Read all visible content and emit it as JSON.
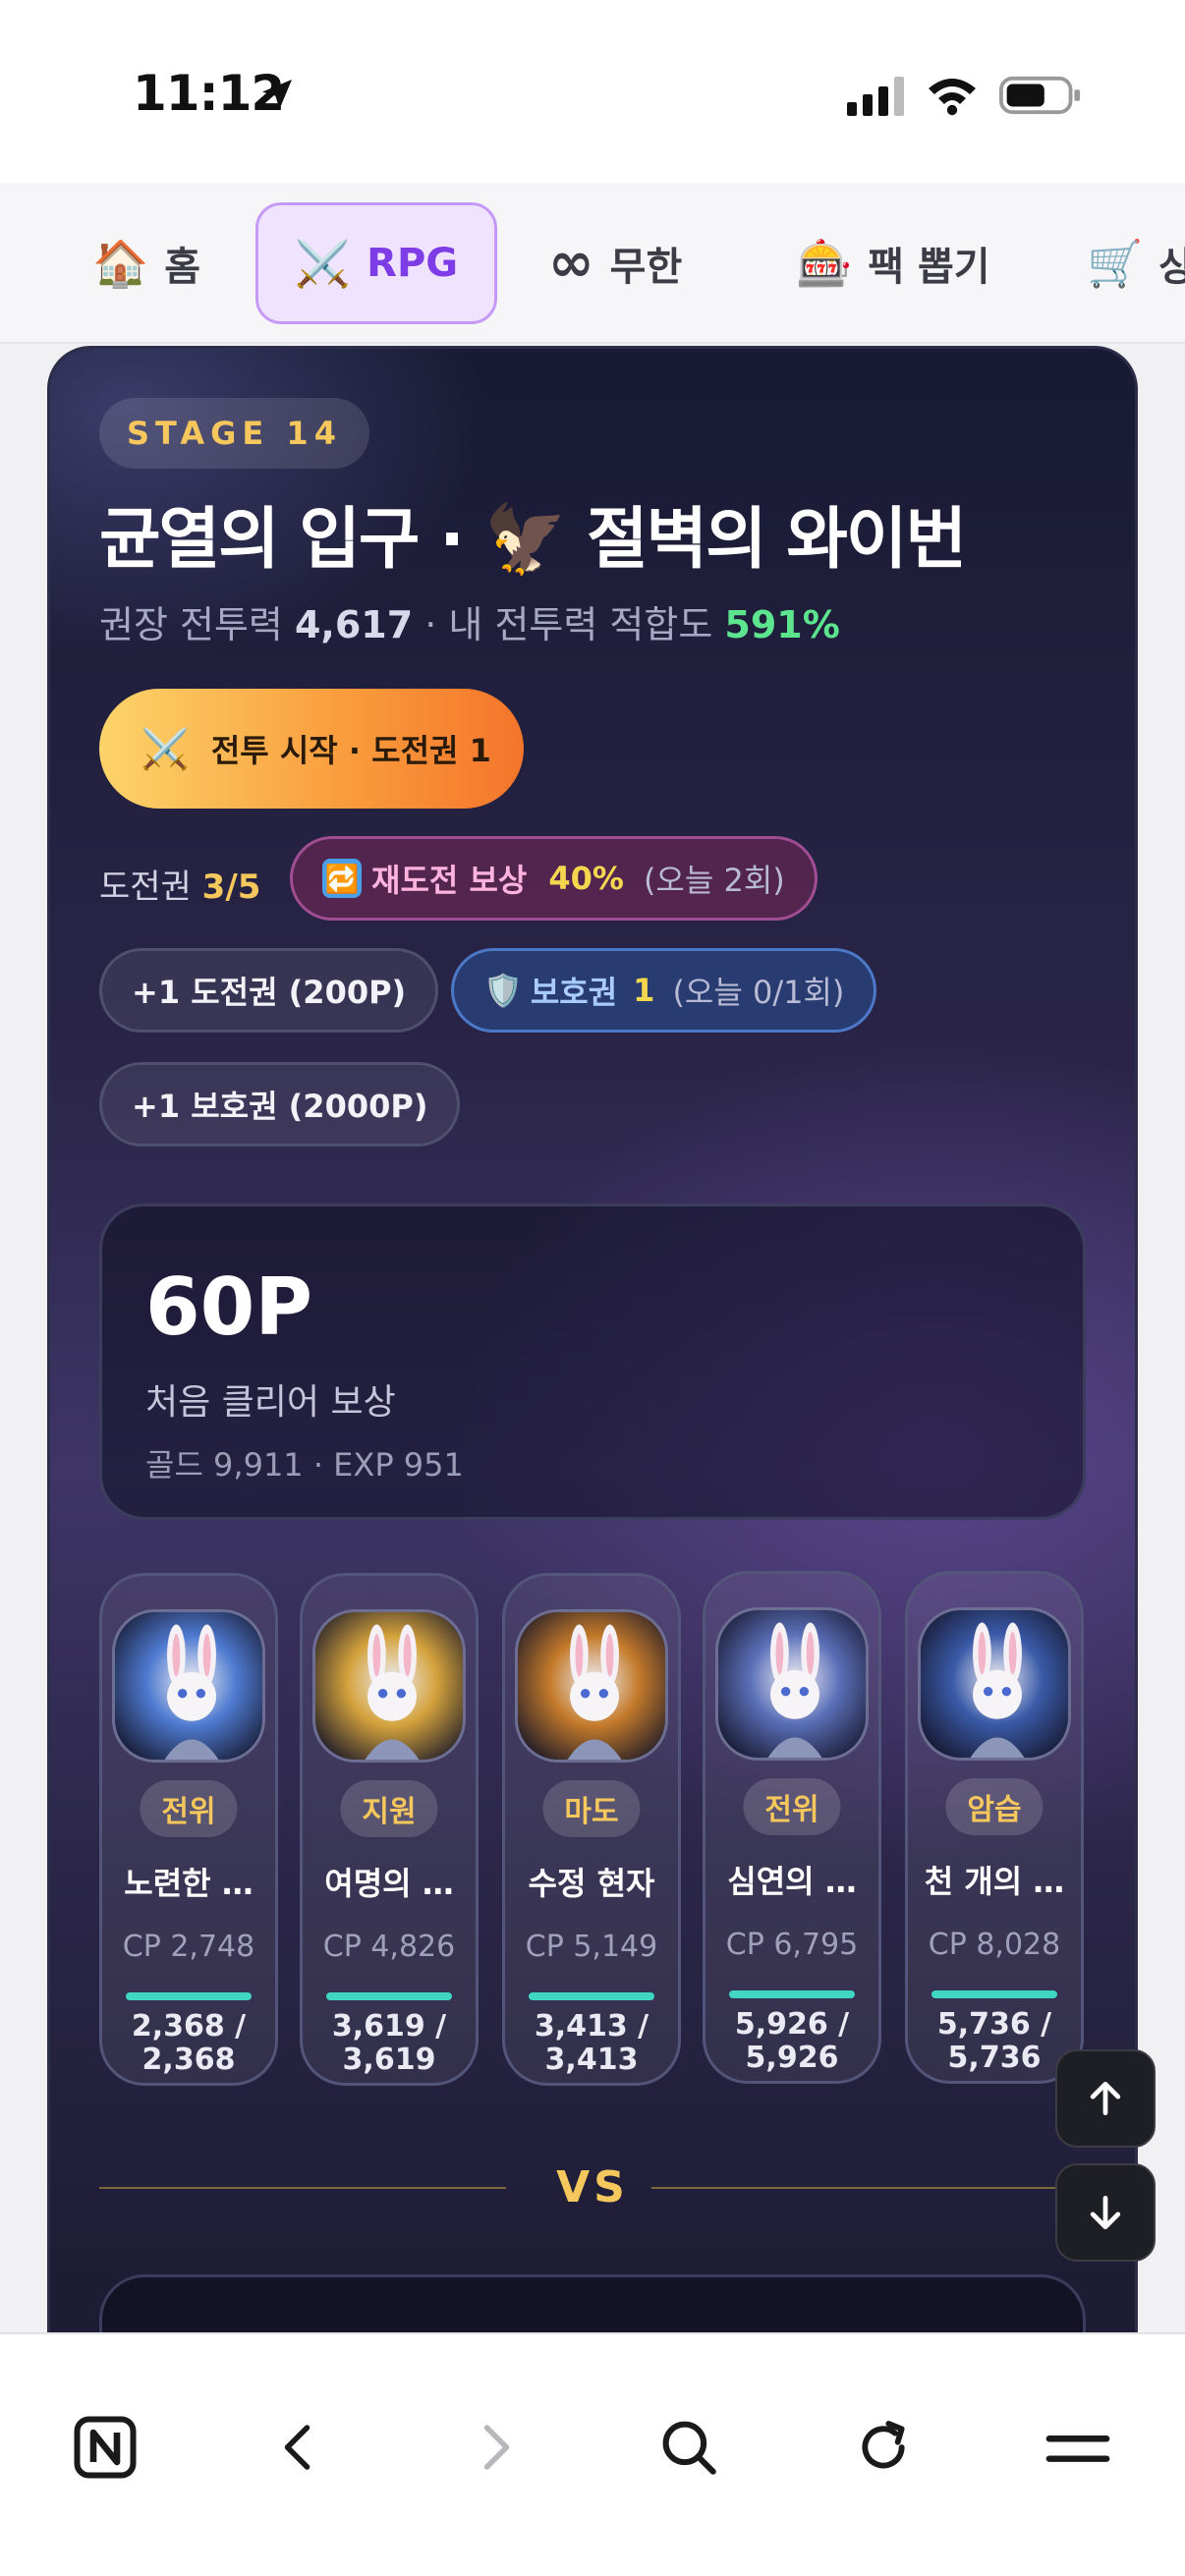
{
  "status": {
    "time": "11:12"
  },
  "tabs": [
    {
      "icon": "🏠",
      "label": "홈"
    },
    {
      "icon": "⚔️",
      "label": "RPG"
    },
    {
      "icon": "∞",
      "label": "무한"
    },
    {
      "icon": "🎰",
      "label": "팩 뽑기"
    },
    {
      "icon": "🛒",
      "label": "상"
    }
  ],
  "stage": {
    "badge": "STAGE 14",
    "title": "균열의 입구 · 🦅 절벽의 와이번",
    "sub_prefix": "권장 전투력 ",
    "recommended_power": "4,617",
    "sub_middle": " · 내 전투력 적합도 ",
    "fit_percent": "591%",
    "start_button_icon": "⚔️",
    "start_button_label": "전투 시작 · 도전권 1"
  },
  "tickets": {
    "label": "도전권 ",
    "count": "3/5",
    "retry_icon": "🔁",
    "retry_label": "재도전 보상",
    "retry_value": "40%",
    "retry_note": "(오늘 2회)",
    "buy_ticket": "+1 도전권 (200P)",
    "shield_icon": "🛡️",
    "shield_label": "보호권",
    "shield_count": "1",
    "shield_note": "(오늘 0/1회)",
    "buy_shield": "+1 보호권 (2000P)"
  },
  "reward": {
    "points": "60P",
    "label": "처음 클리어 보상",
    "detail": "골드 9,911 · EXP 951"
  },
  "heroes": [
    {
      "role": "전위",
      "name": "노련한 …",
      "cp": "CP 2,748",
      "hp": "2,368 / 2,368",
      "hp_fraction": 1.0,
      "color": "#4e7ad0"
    },
    {
      "role": "지원",
      "name": "여명의 …",
      "cp": "CP 4,826",
      "hp": "3,619 / 3,619",
      "hp_fraction": 1.0,
      "color": "#d4a23c"
    },
    {
      "role": "마도",
      "name": "수정 현자",
      "cp": "CP 5,149",
      "hp": "3,413 / 3,413",
      "hp_fraction": 1.0,
      "color": "#c47a2a"
    },
    {
      "role": "전위",
      "name": "심연의 …",
      "cp": "CP 6,795",
      "hp": "5,926 / 5,926",
      "hp_fraction": 1.0,
      "color": "#5a6fb8"
    },
    {
      "role": "암습",
      "name": "천 개의 …",
      "cp": "CP 8,028",
      "hp": "5,736 / 5,736",
      "hp_fraction": 1.0,
      "color": "#3a5aa8"
    }
  ],
  "vs": "VS",
  "colors": {
    "accent_gold": "#f5c75c",
    "fit_green": "#5ce58e",
    "tab_active": "#7d3ce6",
    "hp_bar": "#3fd6c4"
  },
  "icons": {
    "scroll_up": "arrow-up-icon",
    "scroll_down": "arrow-down-icon",
    "browser": [
      "notion-app-icon",
      "back-icon",
      "forward-icon",
      "search-icon",
      "reload-icon",
      "menu-icon"
    ]
  }
}
